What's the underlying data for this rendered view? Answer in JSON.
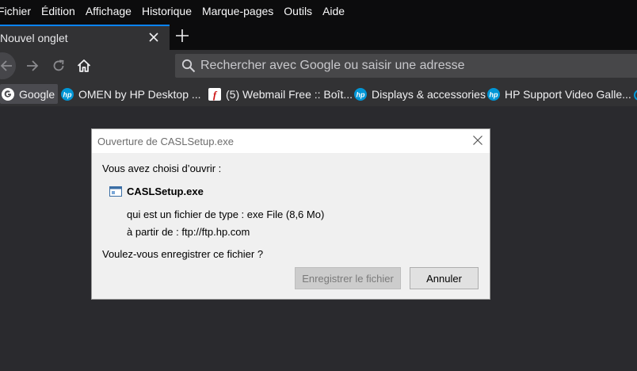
{
  "menubar": {
    "items": [
      "Fichier",
      "Édition",
      "Affichage",
      "Historique",
      "Marque-pages",
      "Outils",
      "Aide"
    ]
  },
  "tabs": [
    {
      "label": "Nouvel onglet",
      "active": true
    }
  ],
  "navbar": {
    "search_placeholder": "Rechercher avec Google ou saisir une adresse"
  },
  "bookmarks": [
    {
      "label": "Google",
      "icon": "google-icon"
    },
    {
      "label": "OMEN by HP Desktop ...",
      "icon": "hp-icon"
    },
    {
      "label": "(5) Webmail Free :: Boît...",
      "icon": "flash-icon"
    },
    {
      "label": "Displays & accessories",
      "icon": "hp-icon"
    },
    {
      "label": "HP Support Video Galle...",
      "icon": "hp-icon"
    }
  ],
  "dialog": {
    "title": "Ouverture de CASLSetup.exe",
    "intro": "Vous avez choisi d’ouvrir :",
    "filename": "CASLSetup.exe",
    "type_line": "qui est un fichier de type : exe File (8,6 Mo)",
    "source_line": "à partir de : ftp://ftp.hp.com",
    "question": "Voulez-vous enregistrer ce fichier ?",
    "save_label": "Enregistrer le fichier",
    "cancel_label": "Annuler"
  },
  "colors": {
    "accent": "#0a84ff",
    "chrome_dark": "#0c0c0d",
    "toolbar": "#323234",
    "content_bg": "#2a2a2e"
  }
}
